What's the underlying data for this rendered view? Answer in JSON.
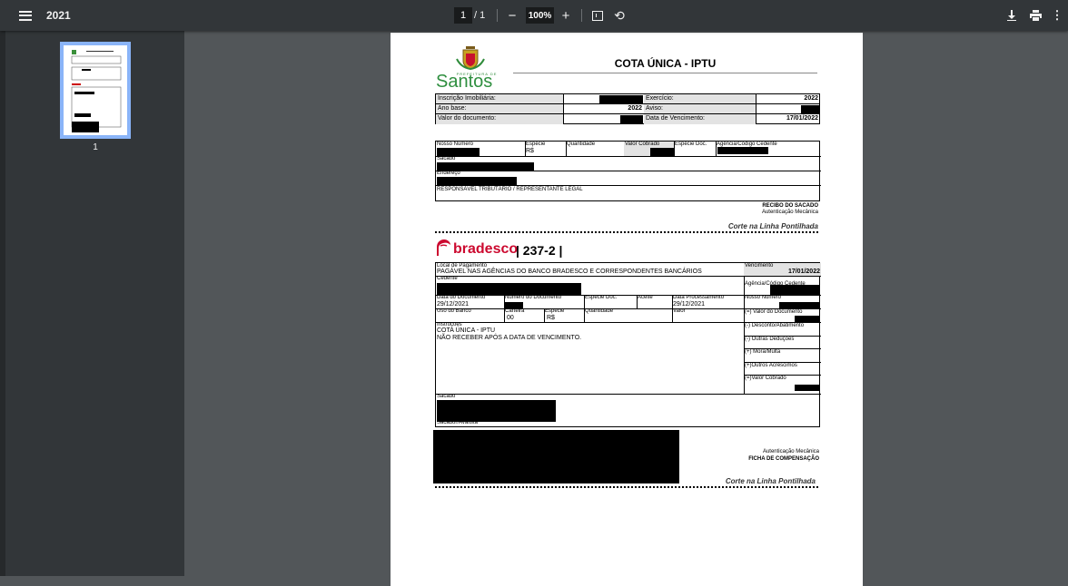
{
  "toolbar": {
    "title": "2021",
    "current_page": "1",
    "page_sep": "/ 1",
    "zoom": "100%",
    "zoom_out_label": "−",
    "zoom_in_label": "+"
  },
  "sidebar": {
    "thumb_label": "1"
  },
  "logo": {
    "prefeitura": "PREFEITURA DE",
    "city": "Santos"
  },
  "doc": {
    "title": "COTA ÚNICA - IPTU",
    "rows": [
      {
        "l1": "Inscrição Imobiliária:",
        "v1": "",
        "l2": "Exercício:",
        "v2": "2022"
      },
      {
        "l1": "Ano base:",
        "v1": "2022",
        "l2": "Aviso:",
        "v2": ""
      },
      {
        "l1": "Valor do documento:",
        "v1": "",
        "l2": "Data de Vencimento:",
        "v2": "17/01/2022"
      }
    ],
    "recibo": {
      "nosso_numero": "Nosso Número",
      "especie": "Espécie",
      "especie_val": "R$",
      "quantidade": "Quantidade",
      "valor_cobrado": "Valor Cobrado",
      "especie_doc": "Espécie Doc.",
      "agencia": "Agência/Código Cedente",
      "sacado": "Sacado",
      "endereco": "Endereço",
      "responsavel": "RESPONSÁVEL TRIBUTÁRIO / REPRESENTANTE LEGAL"
    },
    "recibo_sacado": "RECIBO DO SACADO",
    "autenticacao": "Autenticação Mecânica",
    "corte": "Corte na Linha Pontilhada",
    "bank": {
      "name": "bradesco",
      "code": "| 237-2 |"
    },
    "ficha": {
      "local_pagamento": "Local de Pagamento",
      "local_val": "PAGÁVEL NAS AGÊNCIAS DO BANCO BRADESCO E CORRESPONDENTES BANCÁRIOS",
      "vencimento": "Vencimento",
      "vencimento_val": "17/01/2022",
      "cedente": "Cedente",
      "agencia": "Agência/Código Cedente",
      "data_documento": "Data do Documento",
      "data_documento_val": "29/12/2021",
      "numero_documento": "Número do Documento",
      "especie_doc": "Espécie Doc.",
      "aceite": "Aceite",
      "data_processamento": "Data Processamento",
      "data_processamento_val": "29/12/2021",
      "nosso_numero": "Nosso Número",
      "uso_banco": "Uso do Banco",
      "carteira": "Carteira",
      "carteira_val": "00",
      "especie": "Espécie",
      "especie_val": "R$",
      "quantidade": "Quantidade",
      "valor": "Valor",
      "valor_documento": "(=) Valor do Documento",
      "instrucoes": "Instruções",
      "instr1": "COTA ÚNICA - IPTU",
      "instr2": "NÃO RECEBER APÓS A DATA DE VENCIMENTO.",
      "desconto": "(-) Desconto/Abatimento",
      "deducoes": "(-) Outras Deduções",
      "mora": "(+) Mora/Multa",
      "acrescimos": "(+)Outros Acréscimos",
      "valor_cobrado": "(=)Valor Cobrado",
      "sacado": "Sacado",
      "sacador": "Sacador/Avalista"
    },
    "autenticacao2": "Autenticação Mecânica",
    "ficha_compensacao": "FICHA DE COMPENSAÇÃO",
    "corte2": "Corte na Linha Pontilhada"
  }
}
